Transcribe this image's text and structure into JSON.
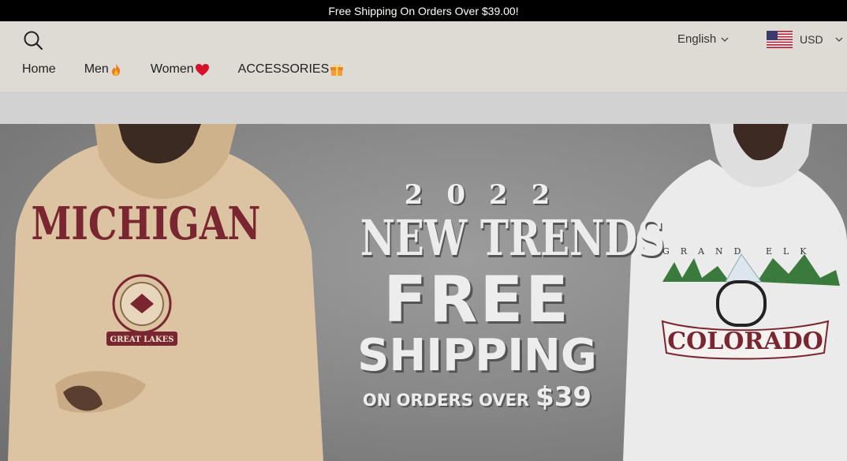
{
  "announcement": {
    "text": "Free Shipping On Orders Over $39.00!"
  },
  "header": {
    "search_icon": "search-icon",
    "language": {
      "label": "English",
      "icon": "chevron-down-icon"
    },
    "currency": {
      "label": "USD",
      "flag": "us-flag-icon",
      "icon": "chevron-down-icon"
    }
  },
  "nav": {
    "items": [
      {
        "label": "Home",
        "icon": ""
      },
      {
        "label": "Men",
        "icon": "fire-icon"
      },
      {
        "label": "Women",
        "icon": "heart-icon"
      },
      {
        "label": "ACCESSORIES",
        "icon": "gift-icon"
      }
    ]
  },
  "hero": {
    "year": "2022",
    "headline": "NEW TRENDS",
    "free": "FREE",
    "shipping": "SHIPPING",
    "orders_prefix": "ON ORDERS OVER",
    "orders_amount": "$39",
    "left_shirt_text": "MICHIGAN",
    "left_badge_text": "GREAT LAKES",
    "right_shirt_top": "GRAND ELK",
    "right_shirt_text": "COLORADO",
    "colors": {
      "left_hoodie": "#d9c2a0",
      "right_hoodie": "#ececec",
      "accent": "#7a2630"
    }
  }
}
